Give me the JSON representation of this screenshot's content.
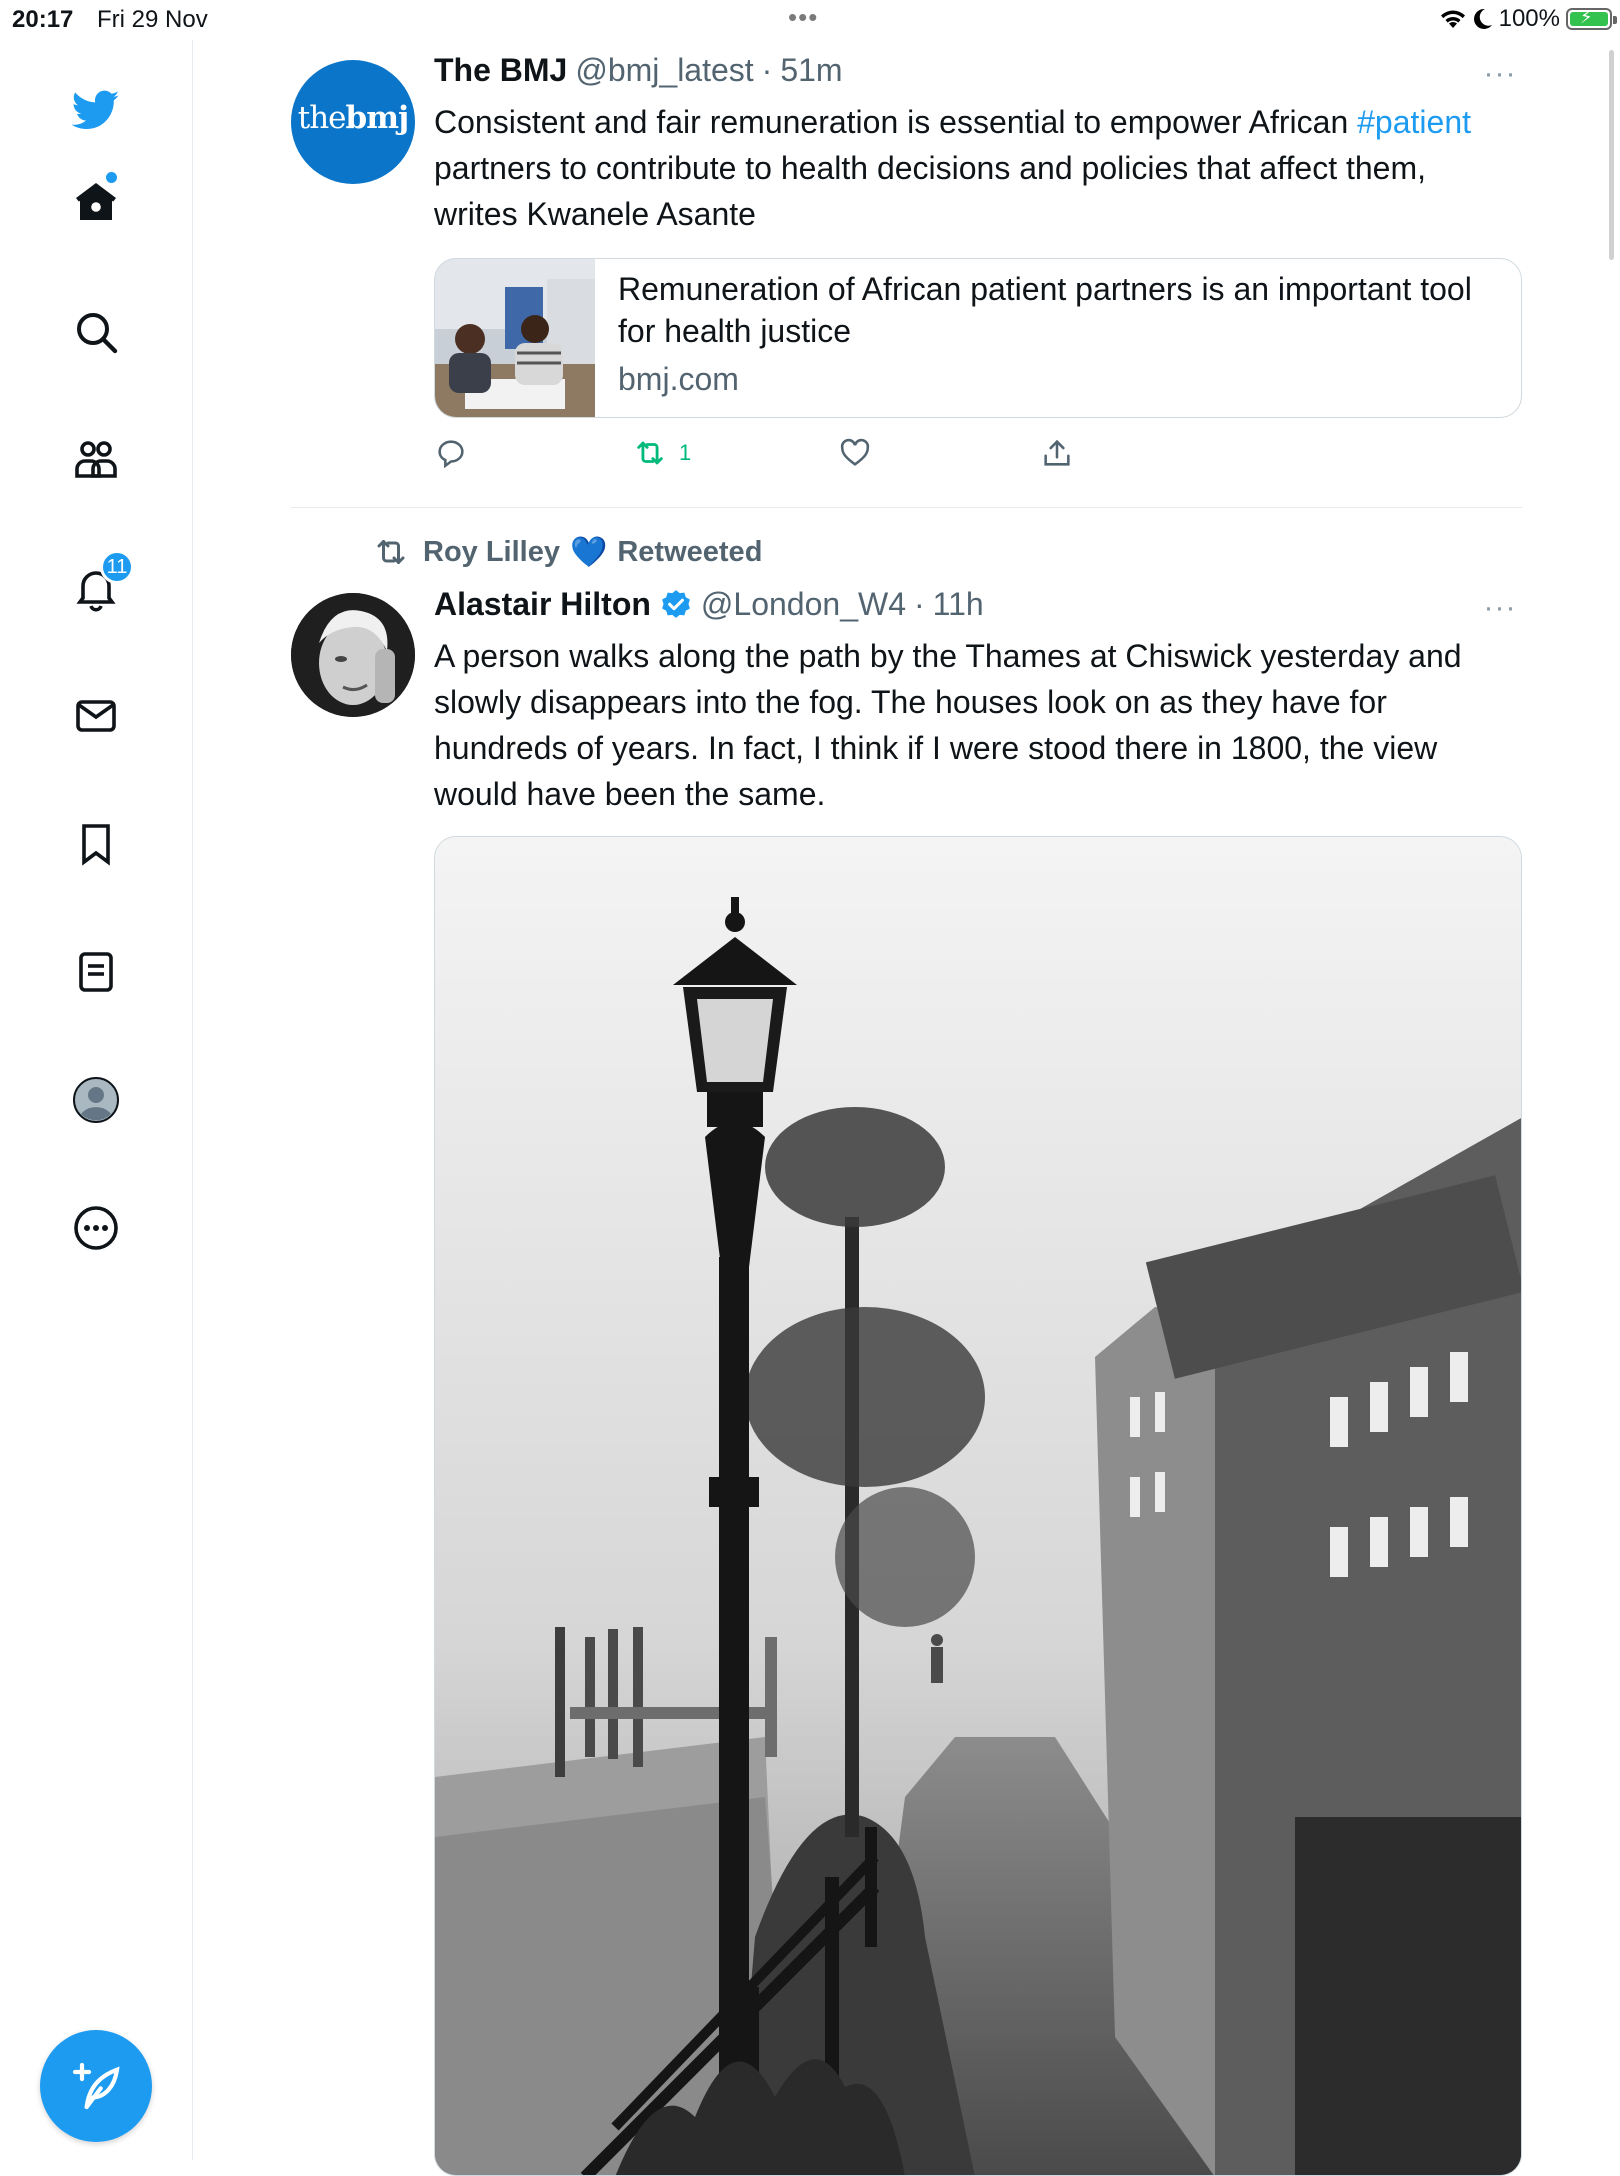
{
  "status_bar": {
    "time": "20:17",
    "date": "Fri 29 Nov",
    "battery_percent": "100%",
    "battery_level": 1.0,
    "icons": [
      "multitasking-dots-icon",
      "wifi-icon",
      "moon-icon",
      "battery-charging-icon"
    ]
  },
  "sidebar": {
    "items": [
      {
        "name": "twitter-logo-icon"
      },
      {
        "name": "home-icon",
        "has_new_dot": true
      },
      {
        "name": "search-icon"
      },
      {
        "name": "communities-icon"
      },
      {
        "name": "notifications-icon",
        "badge": "11"
      },
      {
        "name": "messages-icon"
      },
      {
        "name": "bookmarks-icon"
      },
      {
        "name": "lists-icon"
      },
      {
        "name": "profile-icon"
      },
      {
        "name": "more-icon"
      }
    ],
    "compose_icon": "compose-feather-icon"
  },
  "colors": {
    "accent": "#1d9bf0",
    "retweet_green": "#00ba7c",
    "secondary_text": "#536471",
    "bmj_blue": "#0a75c9"
  },
  "tweets": [
    {
      "avatar_text": {
        "the": "the",
        "bmj": "bmj"
      },
      "name": "The BMJ",
      "handle": "@bmj_latest",
      "separator": "·",
      "time": "51m",
      "text_parts": [
        "Consistent and fair remuneration is essential to empower African ",
        "#patient",
        " partners to contribute to health decisions and policies that affect them, writes Kwanele Asante"
      ],
      "card": {
        "title": "Remuneration of African patient partners is an important tool for health justice",
        "domain": "bmj.com"
      },
      "actions": {
        "replies": "",
        "retweets": "1",
        "likes": "",
        "share": ""
      }
    },
    {
      "retweeted_by": "Roy Lilley",
      "retweeted_emoji": "💙",
      "retweeted_label": "Retweeted",
      "name": "Alastair Hilton",
      "handle": "@London_W4",
      "separator": "·",
      "time": "11h",
      "verified": true,
      "text": "A person walks along the path by the Thames at Chiswick yesterday and slowly disappears into the fog. The houses look on as they have for hundreds of years. In fact, I think if I were stood there in 1800, the view would have been the same."
    }
  ]
}
